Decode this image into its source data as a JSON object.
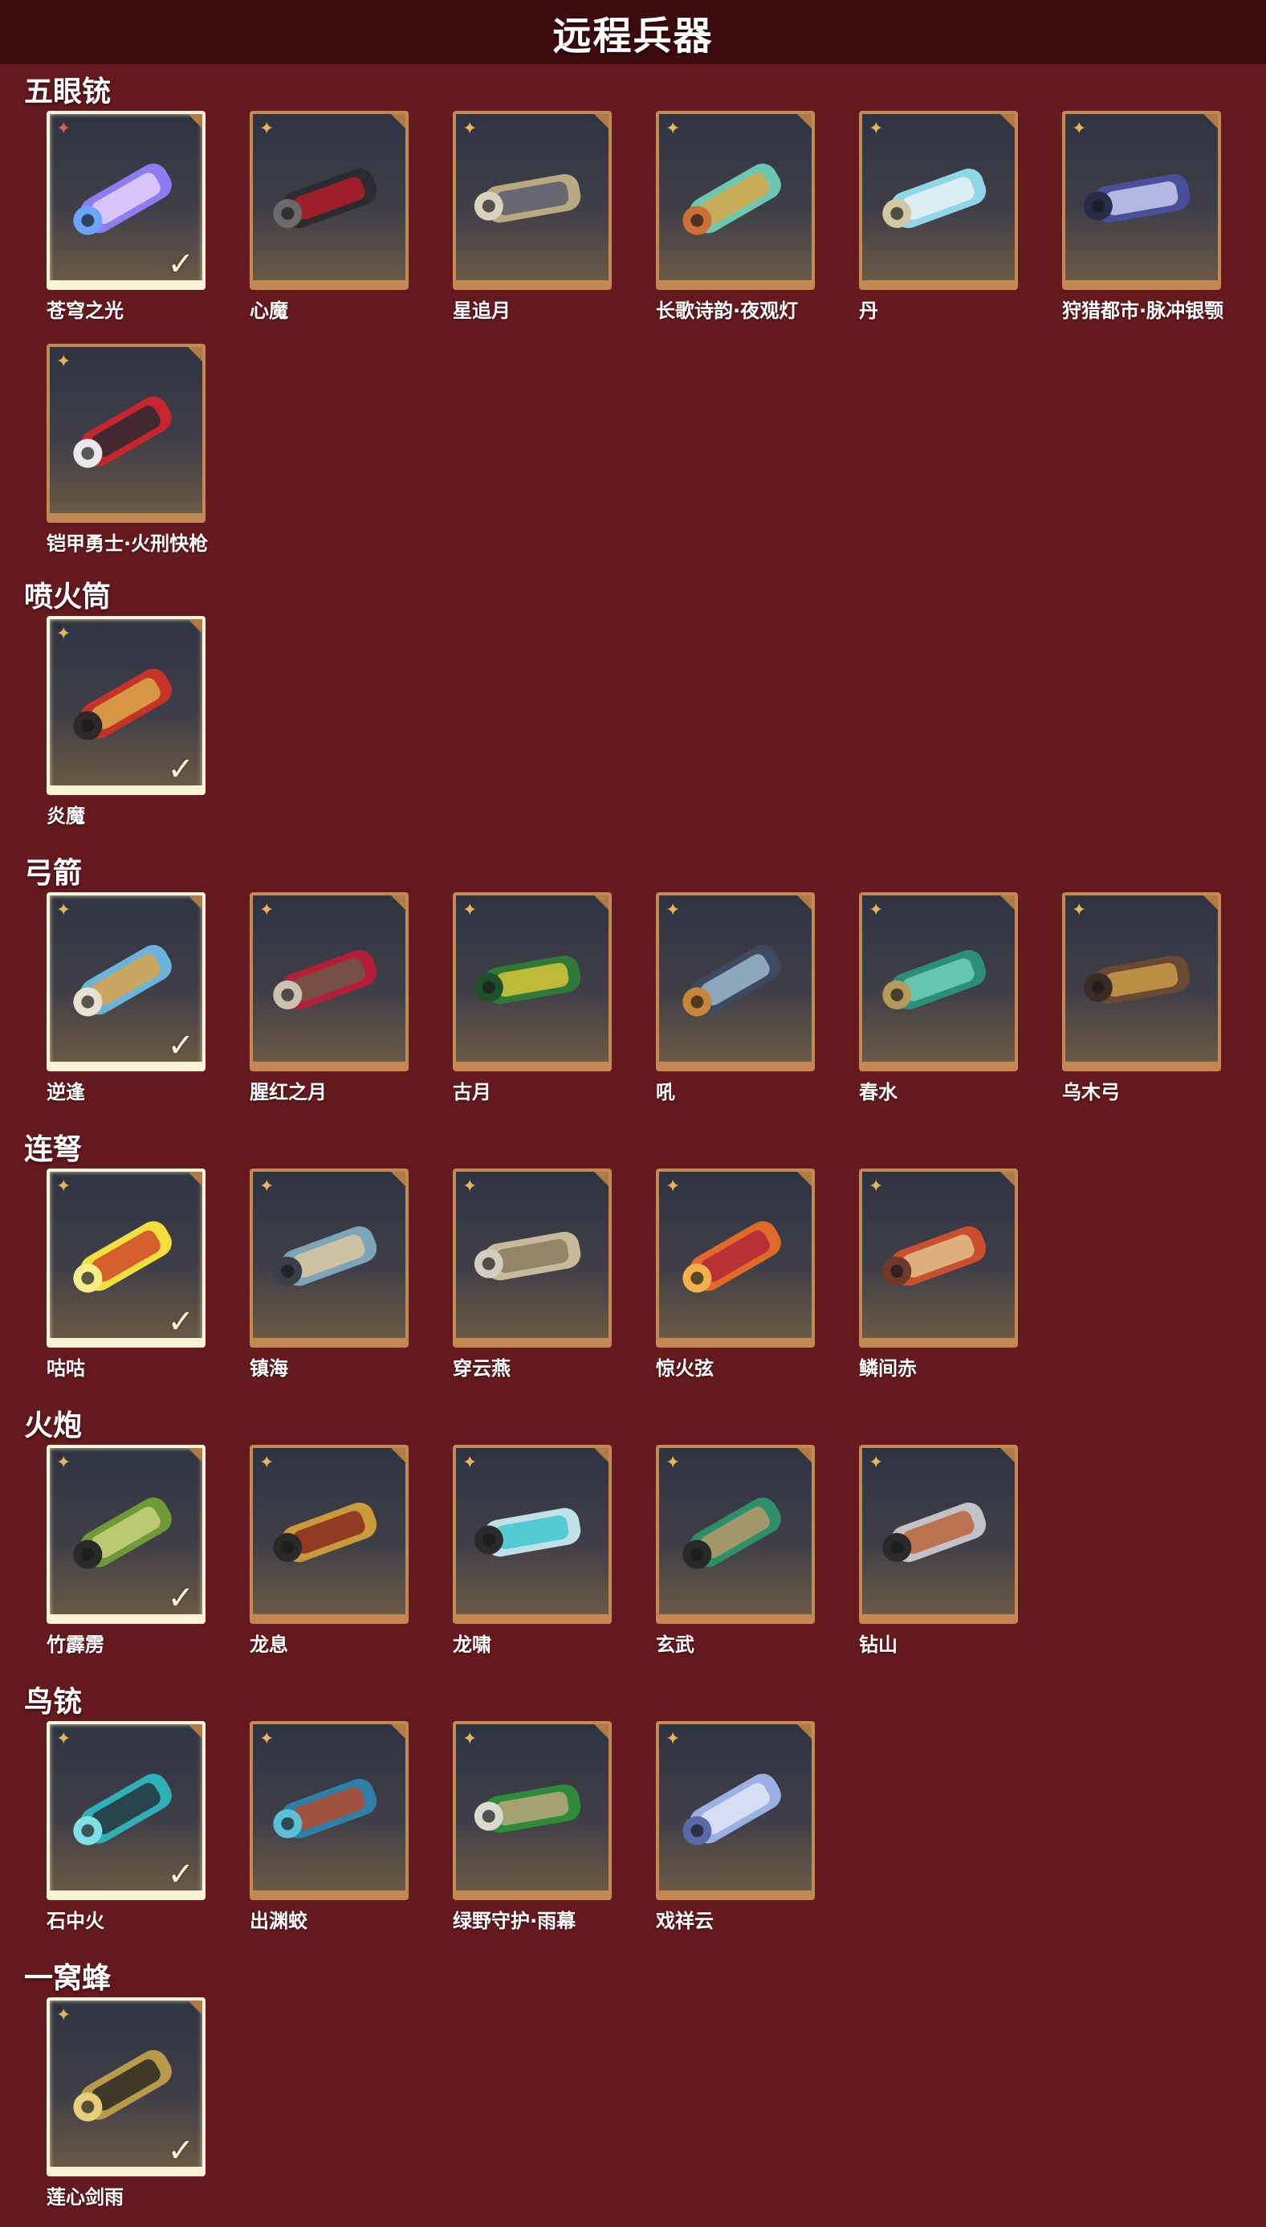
{
  "page_title": "远程兵器",
  "ui": {
    "rarity_star": "✦",
    "check_mark": "✓"
  },
  "colors": {
    "background": "#641a1e",
    "header": "#3e0b0f",
    "card_border": "#c28a52",
    "selected_border": "#fbf3d6",
    "rarity_gold": "#e7b45d",
    "rarity_red": "#e05a64"
  },
  "sections": [
    {
      "title": "五眼铳",
      "items": [
        {
          "name": "苍穹之光",
          "selected": true,
          "rarity": "red",
          "art": [
            "#8f7cf2",
            "#e4d2f8",
            "#6aa6ff"
          ]
        },
        {
          "name": "心魔",
          "selected": false,
          "rarity": "gold",
          "art": [
            "#2c2b30",
            "#b01d2a",
            "#6d6a6e"
          ]
        },
        {
          "name": "星追月",
          "selected": false,
          "rarity": "gold",
          "art": [
            "#b9a982",
            "#5b5c6c",
            "#d9d3bd"
          ]
        },
        {
          "name": "长歌诗韵·夜观灯",
          "selected": false,
          "rarity": "gold",
          "art": [
            "#6cc7b1",
            "#d8a84a",
            "#cf6f38"
          ]
        },
        {
          "name": "丹",
          "selected": false,
          "rarity": "gold",
          "art": [
            "#8fd6e6",
            "#e8f2f4",
            "#d1c8a4"
          ]
        },
        {
          "name": "狩猎都市·脉冲银颚",
          "selected": false,
          "rarity": "gold",
          "art": [
            "#4a4f99",
            "#c7c9ef",
            "#2a2b45"
          ]
        },
        {
          "name": "铠甲勇士·火刑快枪",
          "selected": false,
          "rarity": "gold",
          "art": [
            "#c8262f",
            "#2b2b30",
            "#e9e9e9"
          ]
        }
      ]
    },
    {
      "title": "喷火筒",
      "items": [
        {
          "name": "炎魔",
          "selected": true,
          "rarity": "gold",
          "art": [
            "#c53426",
            "#d9a84a",
            "#2e2a2a"
          ]
        }
      ]
    },
    {
      "title": "弓箭",
      "items": [
        {
          "name": "逆逢",
          "selected": true,
          "rarity": "gold",
          "art": [
            "#6bb3d9",
            "#d9a34c",
            "#e7e1cd"
          ]
        },
        {
          "name": "腥红之月",
          "selected": false,
          "rarity": "gold",
          "art": [
            "#b51e3a",
            "#6b5a45",
            "#c9c2b0"
          ]
        },
        {
          "name": "古月",
          "selected": false,
          "rarity": "gold",
          "art": [
            "#2f7a37",
            "#d7c53a",
            "#1f4f2d"
          ]
        },
        {
          "name": "吼",
          "selected": false,
          "rarity": "gold",
          "art": [
            "#3e4a60",
            "#9db7cf",
            "#c8863a"
          ]
        },
        {
          "name": "春水",
          "selected": false,
          "rarity": "gold",
          "art": [
            "#2c8f7a",
            "#6fd0b7",
            "#b59a5c"
          ]
        },
        {
          "name": "乌木弓",
          "selected": false,
          "rarity": "gold",
          "art": [
            "#6b4a33",
            "#c99a4a",
            "#3b2c28"
          ]
        }
      ]
    },
    {
      "title": "连弩",
      "items": [
        {
          "name": "咕咕",
          "selected": true,
          "rarity": "gold",
          "art": [
            "#f2de3c",
            "#d14a2a",
            "#f7ec8a"
          ]
        },
        {
          "name": "镇海",
          "selected": false,
          "rarity": "gold",
          "art": [
            "#7ea4b8",
            "#d9c89c",
            "#3a3f4a"
          ]
        },
        {
          "name": "穿云燕",
          "selected": false,
          "rarity": "gold",
          "art": [
            "#c9b99a",
            "#8c7a5c",
            "#d2cdc0"
          ]
        },
        {
          "name": "惊火弦",
          "selected": false,
          "rarity": "gold",
          "art": [
            "#e06a2a",
            "#b3263a",
            "#f2b04a"
          ]
        },
        {
          "name": "鳞间赤",
          "selected": false,
          "rarity": "gold",
          "art": [
            "#c9502f",
            "#e2c08a",
            "#6f3a2a"
          ]
        }
      ]
    },
    {
      "title": "火炮",
      "items": [
        {
          "name": "竹霹雳",
          "selected": true,
          "rarity": "gold",
          "art": [
            "#6f9a3a",
            "#c9d27a",
            "#2a2a2a"
          ]
        },
        {
          "name": "龙息",
          "selected": false,
          "rarity": "gold",
          "art": [
            "#c89a3a",
            "#8a2a1f",
            "#2a2a2a"
          ]
        },
        {
          "name": "龙啸",
          "selected": false,
          "rarity": "gold",
          "art": [
            "#bfe0e4",
            "#3fc6d1",
            "#2a2a2a"
          ]
        },
        {
          "name": "玄武",
          "selected": false,
          "rarity": "gold",
          "art": [
            "#2e8f6a",
            "#b89a6a",
            "#2a2a2a"
          ]
        },
        {
          "name": "钻山",
          "selected": false,
          "rarity": "gold",
          "art": [
            "#c2c2c6",
            "#b8643a",
            "#2a2a2a"
          ]
        }
      ]
    },
    {
      "title": "鸟铳",
      "items": [
        {
          "name": "石中火",
          "selected": true,
          "rarity": "gold",
          "art": [
            "#2fb0b8",
            "#263238",
            "#7fe0e6"
          ]
        },
        {
          "name": "出渊蛟",
          "selected": false,
          "rarity": "gold",
          "art": [
            "#2f7fa8",
            "#b34a2a",
            "#5ac0d8"
          ]
        },
        {
          "name": "绿野守护·雨幕",
          "selected": false,
          "rarity": "gold",
          "art": [
            "#2f8a3a",
            "#b9a77a",
            "#d7dbd0"
          ]
        },
        {
          "name": "戏祥云",
          "selected": false,
          "rarity": "gold",
          "art": [
            "#9ab0e0",
            "#dfe6f5",
            "#5a6aa8"
          ]
        }
      ]
    },
    {
      "title": "一窝蜂",
      "items": [
        {
          "name": "莲心剑雨",
          "selected": true,
          "rarity": "gold",
          "art": [
            "#b89a4a",
            "#2a2a22",
            "#e6cf7a"
          ]
        }
      ]
    }
  ]
}
